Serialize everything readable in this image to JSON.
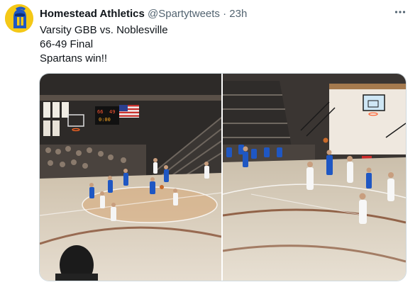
{
  "tweet": {
    "display_name": "Homestead Athletics",
    "handle": "@Spartytweets",
    "separator": "·",
    "time": "23h",
    "more_icon": "more-horizontal-icon",
    "lines": [
      "Varsity GBB vs. Noblesville",
      "66-49 Final",
      "Spartans win!!"
    ],
    "scoreboard": {
      "home": "66",
      "away": "49",
      "period": "4",
      "clock": "0:00"
    }
  },
  "colors": {
    "avatar_bg": "#f4c817",
    "spartan_blue": "#1f57c3",
    "text_secondary": "#536471",
    "border": "#cfd9de"
  }
}
